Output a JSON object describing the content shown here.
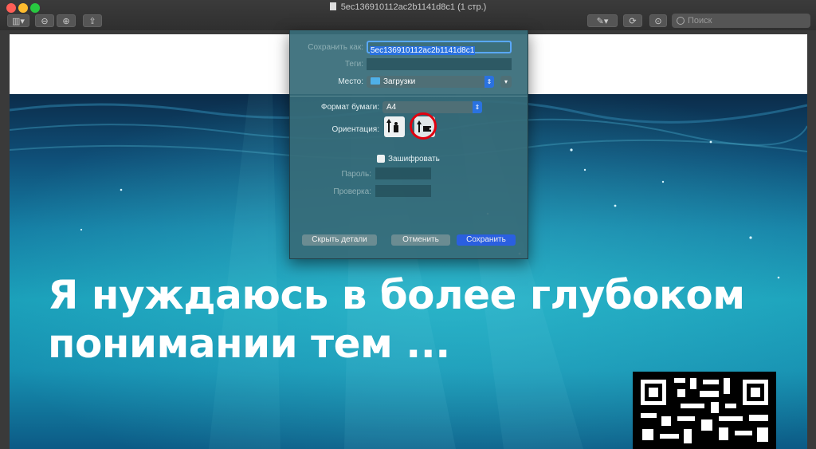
{
  "window": {
    "title": "5ec136910112ac2b1141d8c1 (1 стр.)",
    "search_placeholder": "Поиск",
    "traffic_lights": {
      "close": "#ff5f57",
      "minimize": "#febc2e",
      "zoom": "#28c840"
    }
  },
  "document": {
    "headline_line1": "Я нуждаюсь в более глубоком",
    "headline_line2": "понимании тем ..."
  },
  "dialog": {
    "save_as_label": "Сохранить как:",
    "save_as_value": "5ec136910112ac2b1141d8c1",
    "tags_label": "Теги:",
    "location_label": "Место:",
    "location_value": "Загрузки",
    "paper_format_label": "Формат бумаги:",
    "paper_format_value": "A4",
    "orientation_label": "Ориентация:",
    "encrypt_label": "Зашифровать",
    "encrypt_checked": false,
    "password_label": "Пароль:",
    "verify_label": "Проверка:",
    "hide_details_button": "Скрыть детали",
    "cancel_button": "Отменить",
    "save_button": "Сохранить",
    "accent_color": "#2a72e0",
    "highlight_color": "#e0000f"
  }
}
